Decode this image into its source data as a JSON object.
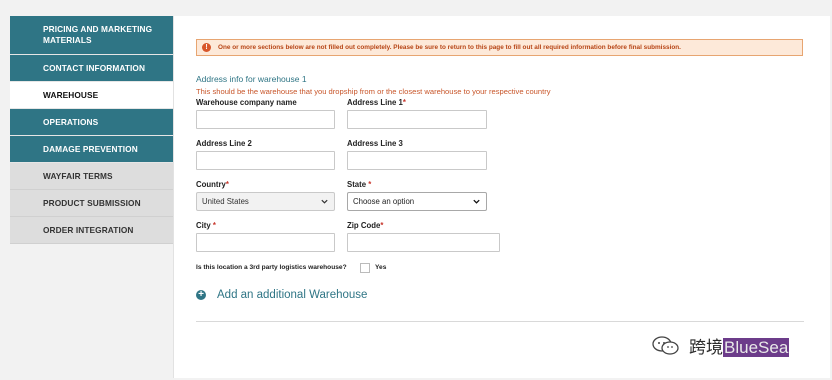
{
  "sidebar": {
    "items": [
      {
        "label": "PRICING AND MARKETING MATERIALS"
      },
      {
        "label": "CONTACT INFORMATION"
      },
      {
        "label": "WAREHOUSE"
      },
      {
        "label": "OPERATIONS"
      },
      {
        "label": "DAMAGE PREVENTION"
      },
      {
        "label": "WAYFAIR TERMS"
      },
      {
        "label": "PRODUCT SUBMISSION"
      },
      {
        "label": "ORDER INTEGRATION"
      }
    ]
  },
  "alert": {
    "icon": "exclamation-icon",
    "text": "One or more sections below are not filled out completely. Please be sure to return to this page to fill out all required information before final submission."
  },
  "form": {
    "section_title": "Address info for warehouse 1",
    "section_note": "This should be the warehouse that you dropship from or the closest warehouse to your respective country",
    "company_label": "Warehouse company name",
    "address1_label": "Address Line 1",
    "address2_label": "Address Line 2",
    "address3_label": "Address Line 3",
    "country_label": "Country",
    "country_value": "United States",
    "state_label": "State",
    "state_value": "Choose an option",
    "city_label": "City",
    "zip_label": "Zip Code",
    "required_mark": "*",
    "third_party_question": "Is this location a 3rd party logistics warehouse?",
    "third_party_option": "Yes",
    "add_warehouse_label": "Add an additional Warehouse"
  },
  "watermark": {
    "text_prefix": "跨境",
    "text_highlight": "BlueSea"
  },
  "colors": {
    "teal": "#2f7585",
    "alert_bg": "#fde9d9",
    "alert_text": "#b74516",
    "required": "#c8372d"
  }
}
